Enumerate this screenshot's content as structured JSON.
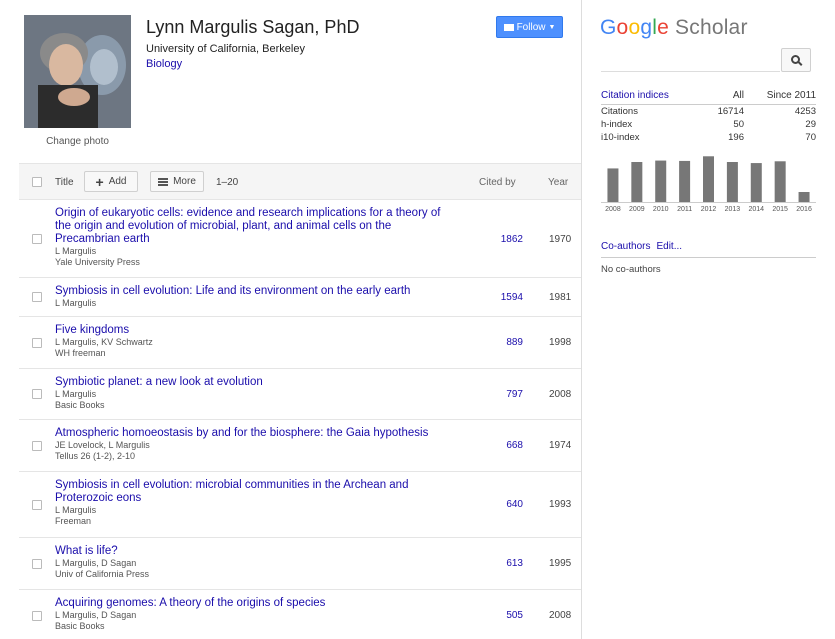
{
  "profile": {
    "name": "Lynn Margulis Sagan, PhD",
    "affiliation": "University of California, Berkeley",
    "field": "Biology",
    "change_photo": "Change photo",
    "follow_label": "Follow"
  },
  "table": {
    "header": {
      "title_label": "Title",
      "add_label": "Add",
      "more_label": "More",
      "range": "1–20",
      "cited_by_label": "Cited by",
      "year_label": "Year"
    },
    "rows": [
      {
        "title": "Origin of eukaryotic cells: evidence and research implications for a theory of the origin and evolution of microbial, plant, and animal cells on the Precambrian earth",
        "authors": "L Margulis",
        "venue": "Yale University Press",
        "cited": "1862",
        "year": "1970"
      },
      {
        "title": "Symbiosis in cell evolution: Life and its environment on the early earth",
        "authors": "L Margulis",
        "venue": "",
        "cited": "1594",
        "year": "1981"
      },
      {
        "title": "Five kingdoms",
        "authors": "L Margulis, KV Schwartz",
        "venue": "WH freeman",
        "cited": "889",
        "year": "1998"
      },
      {
        "title": "Symbiotic planet: a new look at evolution",
        "authors": "L Margulis",
        "venue": "Basic Books",
        "cited": "797",
        "year": "2008"
      },
      {
        "title": "Atmospheric homoeostasis by and for the biosphere: the Gaia hypothesis",
        "authors": "JE Lovelock, L Margulis",
        "venue": "Tellus 26 (1-2), 2-10",
        "cited": "668",
        "year": "1974"
      },
      {
        "title": "Symbiosis in cell evolution: microbial communities in the Archean and Proterozoic eons",
        "authors": "L Margulis",
        "venue": "Freeman",
        "cited": "640",
        "year": "1993"
      },
      {
        "title": "What is life?",
        "authors": "L Margulis, D Sagan",
        "venue": "Univ of California Press",
        "cited": "613",
        "year": "1995"
      },
      {
        "title": "Acquiring genomes: A theory of the origins of species",
        "authors": "L Margulis, D Sagan",
        "venue": "Basic Books",
        "cited": "505",
        "year": "2008"
      }
    ]
  },
  "sidebar": {
    "logo": {
      "g1": "G",
      "g2": "o",
      "g3": "o",
      "g4": "g",
      "g5": "l",
      "g6": "e",
      "scholar": "Scholar"
    },
    "search_placeholder": "",
    "citation_indices": {
      "heading": "Citation indices",
      "col_all": "All",
      "col_since": "Since 2011",
      "rows": [
        {
          "label": "Citations",
          "all": "16714",
          "since": "4253"
        },
        {
          "label": "h-index",
          "all": "50",
          "since": "29"
        },
        {
          "label": "i10-index",
          "all": "196",
          "since": "70"
        }
      ]
    },
    "coauthors_label": "Co-authors",
    "edit_label": "Edit...",
    "no_coauthors": "No co-authors"
  },
  "chart_data": {
    "type": "bar",
    "categories": [
      "2008",
      "2009",
      "2010",
      "2011",
      "2012",
      "2013",
      "2014",
      "2015",
      "2016"
    ],
    "values": [
      470,
      560,
      580,
      575,
      640,
      560,
      545,
      570,
      140
    ],
    "ylim": [
      0,
      700
    ],
    "colors": {
      "bar": "#777777"
    }
  }
}
